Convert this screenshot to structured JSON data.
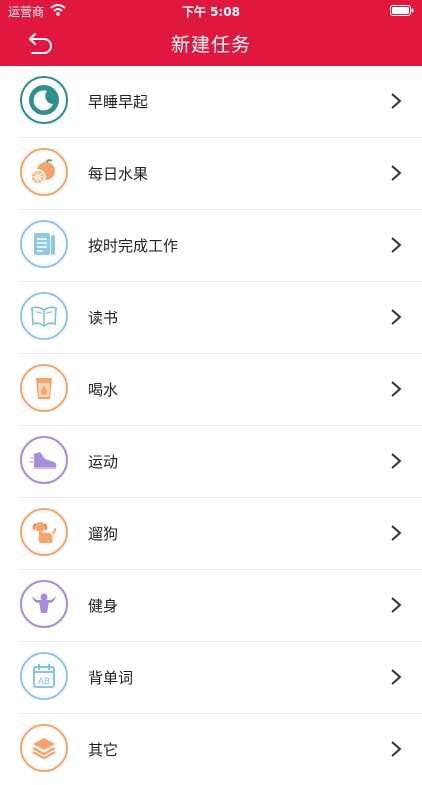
{
  "status_bar": {
    "carrier": "运营商",
    "time": "下午 5:08"
  },
  "nav": {
    "title": "新建任务"
  },
  "colors": {
    "header": "#e0173f",
    "teal": "#2f8f8f",
    "orange": "#f5a46b",
    "blue": "#8fc9e8",
    "purple": "#a98bdc"
  },
  "tasks": [
    {
      "label": "早睡早起",
      "icon": "moon-stars-icon"
    },
    {
      "label": "每日水果",
      "icon": "orange-fruit-icon"
    },
    {
      "label": "按时完成工作",
      "icon": "document-icon"
    },
    {
      "label": "读书",
      "icon": "open-book-icon"
    },
    {
      "label": "喝水",
      "icon": "water-cup-icon"
    },
    {
      "label": "运动",
      "icon": "sneaker-icon"
    },
    {
      "label": "遛狗",
      "icon": "dog-icon"
    },
    {
      "label": "健身",
      "icon": "muscle-man-icon"
    },
    {
      "label": "背单词",
      "icon": "vocabulary-calendar-icon"
    },
    {
      "label": "其它",
      "icon": "layers-icon"
    }
  ]
}
